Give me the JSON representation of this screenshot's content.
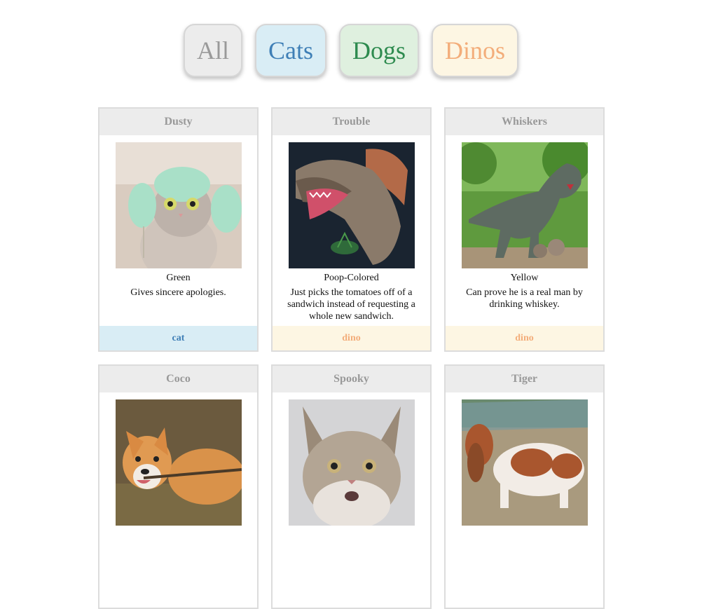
{
  "filters": [
    {
      "label": "All",
      "style": "all"
    },
    {
      "label": "Cats",
      "style": "cats"
    },
    {
      "label": "Dogs",
      "style": "dogs"
    },
    {
      "label": "Dinos",
      "style": "dinos"
    }
  ],
  "colors": {
    "cat_accent": "#3f7fb6",
    "cat_bg": "#d9edf5",
    "dog_accent": "#2e8b4f",
    "dog_bg": "#dff0df",
    "dino_accent": "#f3ad7a",
    "dino_bg": "#fdf6e3"
  },
  "cards": [
    {
      "name": "Dusty",
      "color": "Green",
      "description": "Gives sincere apologies.",
      "type": "cat",
      "image": "cat-with-towel-earmuffs"
    },
    {
      "name": "Trouble",
      "color": "Poop-Colored",
      "description": "Just picks the tomatoes off of a sandwich instead of requesting a whole new sandwich.",
      "type": "dino",
      "image": "spinosaurus-model"
    },
    {
      "name": "Whiskers",
      "color": "Yellow",
      "description": "Can prove he is a real man by drinking whiskey.",
      "type": "dino",
      "image": "t-rex-statue"
    },
    {
      "name": "Coco",
      "color": "",
      "description": "",
      "type": "",
      "image": "corgi-with-stick"
    },
    {
      "name": "Spooky",
      "color": "",
      "description": "",
      "type": "",
      "image": "maine-coon-cat"
    },
    {
      "name": "Tiger",
      "color": "",
      "description": "",
      "type": "",
      "image": "basset-hound"
    }
  ]
}
